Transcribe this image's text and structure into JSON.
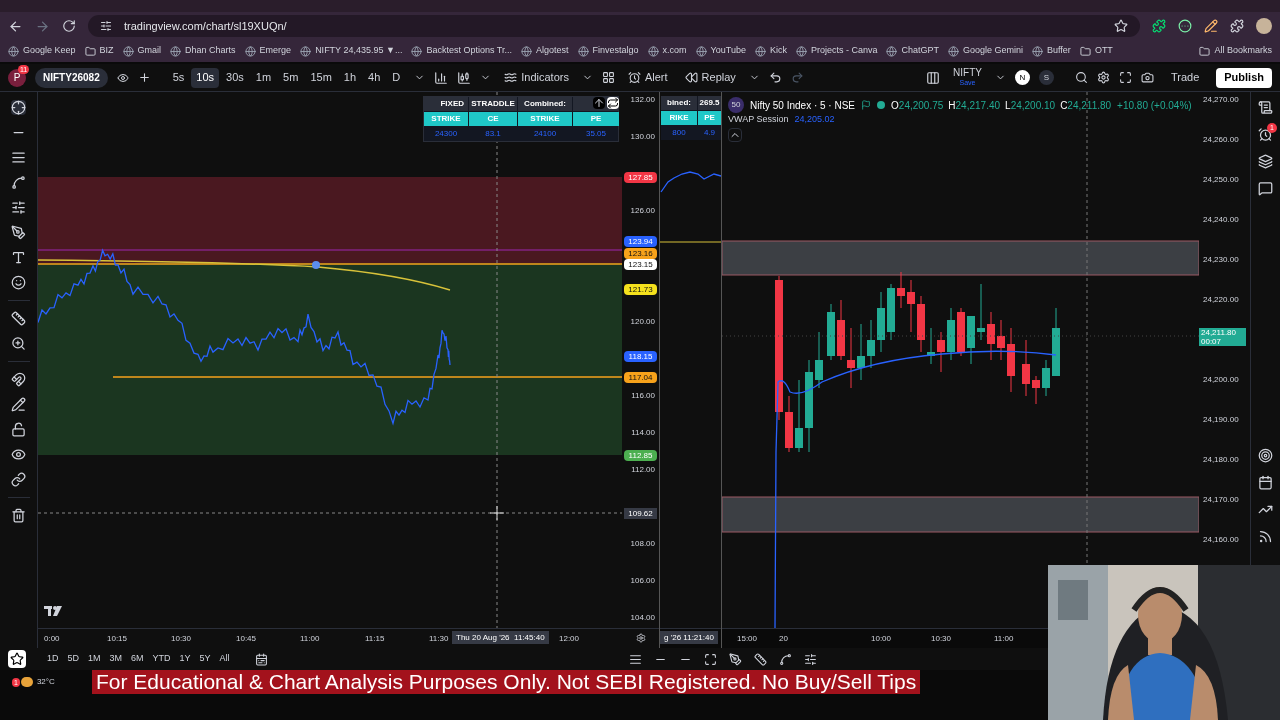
{
  "browser": {
    "url": "tradingview.com/chart/sl19XUQn/",
    "bookmarks": [
      {
        "label": "Google Keep",
        "kind": "site"
      },
      {
        "label": "BIZ",
        "kind": "folder"
      },
      {
        "label": "Gmail",
        "kind": "site"
      },
      {
        "label": "Dhan Charts",
        "kind": "site"
      },
      {
        "label": "Emerge",
        "kind": "site"
      },
      {
        "label": "NIFTY 24,435.95 ▼...",
        "kind": "site"
      },
      {
        "label": "Backtest Options Tr...",
        "kind": "site"
      },
      {
        "label": "Algotest",
        "kind": "site"
      },
      {
        "label": "Finvestalgo",
        "kind": "site"
      },
      {
        "label": "x.com",
        "kind": "site"
      },
      {
        "label": "YouTube",
        "kind": "site"
      },
      {
        "label": "Kick",
        "kind": "site"
      },
      {
        "label": "Projects - Canva",
        "kind": "site"
      },
      {
        "label": "ChatGPT",
        "kind": "site"
      },
      {
        "label": "Google Gemini",
        "kind": "site"
      },
      {
        "label": "Buffer",
        "kind": "site"
      },
      {
        "label": "OTT",
        "kind": "folder"
      }
    ],
    "all_bookmarks": "All Bookmarks"
  },
  "toolbar": {
    "avatar": "P",
    "avatar_badge": "11",
    "symbol": "NIFTY26082",
    "intervals": [
      {
        "label": "5s",
        "selected": false
      },
      {
        "label": "10s",
        "selected": true
      },
      {
        "label": "30s",
        "selected": false
      },
      {
        "label": "1m",
        "selected": false
      },
      {
        "label": "5m",
        "selected": false
      },
      {
        "label": "15m",
        "selected": false
      },
      {
        "label": "1h",
        "selected": false
      },
      {
        "label": "4h",
        "selected": false
      },
      {
        "label": "D",
        "selected": false
      }
    ],
    "indicators": "Indicators",
    "alert": "Alert",
    "replay": "Replay",
    "layout_name": "NIFTY",
    "layout_status": "Save",
    "badges": [
      "N",
      "S"
    ],
    "trade": "Trade",
    "publish": "Publish"
  },
  "left_chart": {
    "table": {
      "header": [
        "FIXED",
        "STRADDLE",
        "Combined:"
      ],
      "columns": [
        "STRIKE",
        "CE",
        "STRIKE",
        "PE"
      ],
      "values": [
        "24300",
        "83.1",
        "24100",
        "35.05"
      ]
    },
    "price_axis": [
      "132.00",
      "130.00",
      "126.00",
      "120.00",
      "116.00",
      "114.00",
      "112.00",
      "108.00",
      "106.00",
      "104.00"
    ],
    "price_labels": [
      {
        "text": "127.85",
        "color": "#f23645"
      },
      {
        "text": "123.94",
        "color": "#2962ff"
      },
      {
        "text": "123.16",
        "color": "#f7a21b"
      },
      {
        "text": "123.15",
        "color": "#ffffff"
      },
      {
        "text": "121.73",
        "color": "#f5e11d"
      },
      {
        "text": "118.15",
        "color": "#2962ff"
      },
      {
        "text": "117.04",
        "color": "#f7a21b"
      },
      {
        "text": "112.85",
        "color": "#4caf50"
      }
    ],
    "crosshair_price": "109.62",
    "time_axis": [
      "0:00",
      "10:15",
      "10:30",
      "10:45",
      "11:00",
      "11:15",
      "11:30",
      "12:00"
    ],
    "crosshair_date": "Thu 20 Aug '26",
    "crosshair_time": "11:45:40"
  },
  "middle_chart": {
    "table": [
      "bined:",
      "269.5",
      "RIKE",
      "PE",
      "800",
      "4.9"
    ],
    "time_label": "g '26  11:21:40"
  },
  "right_chart": {
    "title": "Nifty 50 Index · 5 · NSE",
    "exchange_badge": "50",
    "ohlc": [
      {
        "label": "O",
        "value": "24,200.75"
      },
      {
        "label": "H",
        "value": "24,217.40"
      },
      {
        "label": "L",
        "value": "24,200.10"
      },
      {
        "label": "C",
        "value": "24,211.80"
      }
    ],
    "change": "+10.80 (+0.04%)",
    "vwap_label": "VWAP Session",
    "vwap_value": "24,205.02",
    "price_axis": [
      "24,270.00",
      "24,260.00",
      "24,250.00",
      "24,240.00",
      "24,230.00",
      "24,220.00",
      "24,200.00",
      "24,190.00",
      "24,180.00",
      "24,170.00",
      "24,160.00"
    ],
    "last_price": "24,211.80",
    "countdown": "00:07",
    "time_axis": [
      "15:00",
      "20",
      "10:00",
      "10:30",
      "11:00"
    ]
  },
  "sidebar_badge": "1",
  "ranges": [
    "1D",
    "5D",
    "1M",
    "3M",
    "6M",
    "YTD",
    "1Y",
    "5Y",
    "All"
  ],
  "taskbar": {
    "weather": "32°C",
    "badge": "1"
  },
  "banner": "For Educational & Chart Analysis Purposes Only. Not SEBI Registered. No Buy/Sell Tips"
}
